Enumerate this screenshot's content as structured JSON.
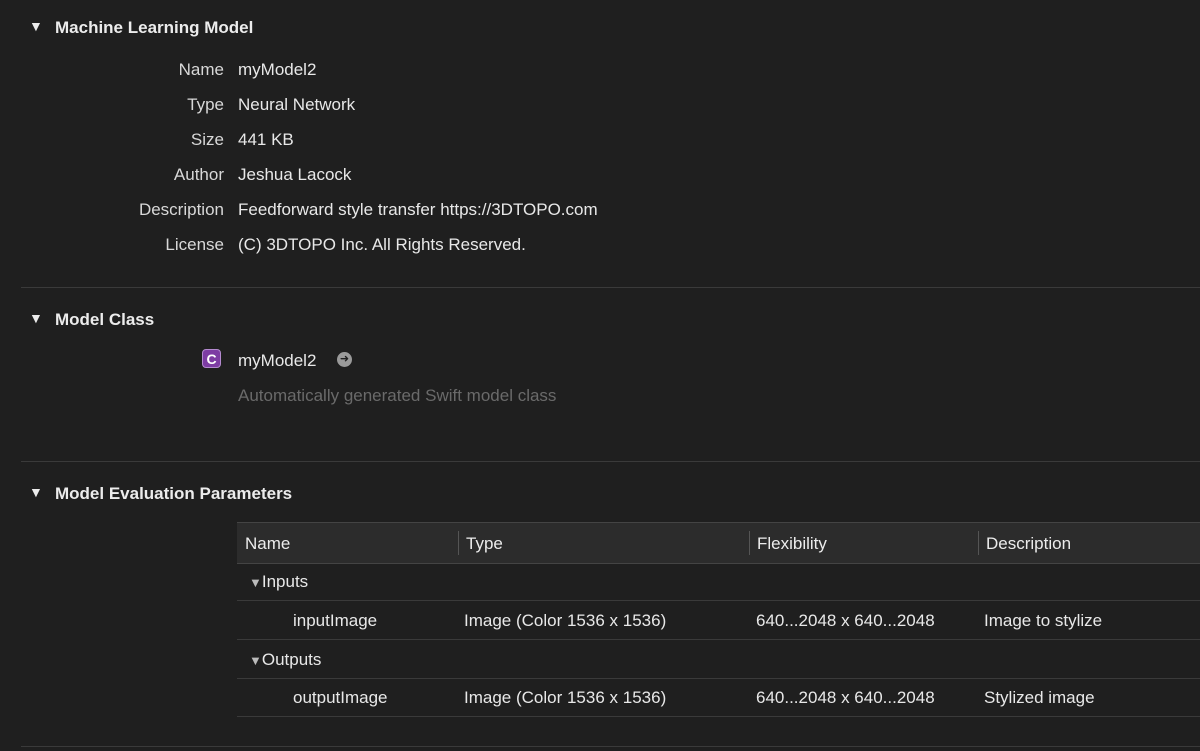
{
  "sections": {
    "ml_model": {
      "title": "Machine Learning Model",
      "fields": [
        {
          "label": "Name",
          "value": "myModel2"
        },
        {
          "label": "Type",
          "value": "Neural Network"
        },
        {
          "label": "Size",
          "value": "441 KB"
        },
        {
          "label": "Author",
          "value": "Jeshua Lacock"
        },
        {
          "label": "Description",
          "value": "Feedforward style transfer https://3DTOPO.com"
        },
        {
          "label": "License",
          "value": "(C) 3DTOPO Inc. All Rights Reserved."
        }
      ]
    },
    "model_class": {
      "title": "Model Class",
      "badge": "C",
      "class_name": "myModel2",
      "subtitle": "Automatically generated Swift model class"
    },
    "eval_params": {
      "title": "Model Evaluation Parameters",
      "columns": [
        "Name",
        "Type",
        "Flexibility",
        "Description"
      ],
      "groups": [
        {
          "label": "Inputs",
          "rows": [
            {
              "name": "inputImage",
              "type": "Image (Color 1536 x 1536)",
              "flexibility": "640...2048 x 640...2048",
              "description": "Image to stylize"
            }
          ]
        },
        {
          "label": "Outputs",
          "rows": [
            {
              "name": "outputImage",
              "type": "Image (Color 1536 x 1536)",
              "flexibility": "640...2048 x 640...2048",
              "description": "Stylized image"
            }
          ]
        }
      ]
    }
  },
  "icons": {
    "disclosure": "disclosure-triangle-icon",
    "go_arrow": "arrow-circle-right-icon"
  },
  "colors": {
    "background": "#1f1f1f",
    "badge": "#7d3ca3"
  }
}
